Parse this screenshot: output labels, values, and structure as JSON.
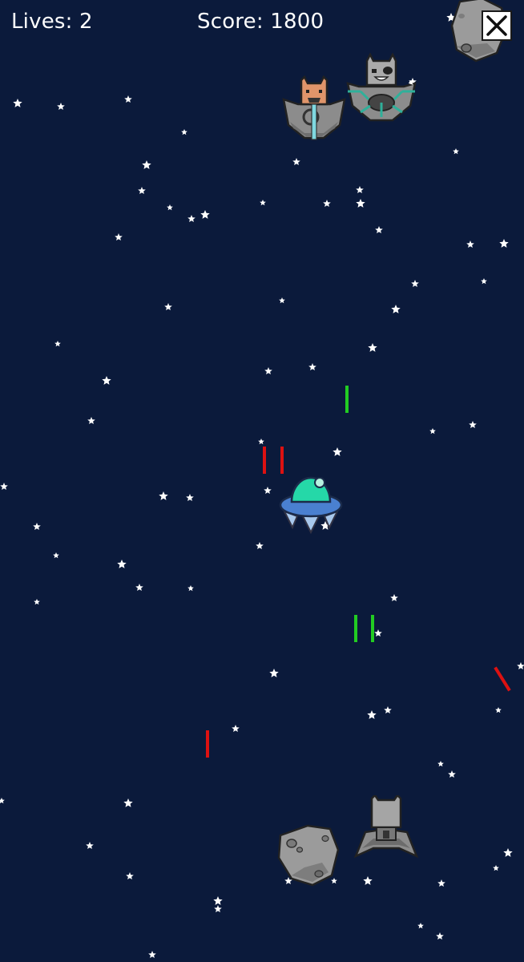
{
  "hud": {
    "lives_label": "Lives: 2",
    "score_label": "Score: 1800"
  },
  "icons": {
    "close": "close-icon",
    "player": "ufo-player-icon",
    "enemy": "enemy-ship-icon",
    "asteroid": "asteroid-icon",
    "star": "star-icon"
  },
  "colors": {
    "background": "#0b1a3b",
    "star": "#ffffff",
    "player_laser": "#22cc22",
    "enemy_laser": "#dd1111",
    "player_dome": "#22ddaa",
    "player_saucer": "#4a80d0",
    "enemy_hull": "#8a8a8a",
    "asteroid": "#9a9a9a"
  }
}
